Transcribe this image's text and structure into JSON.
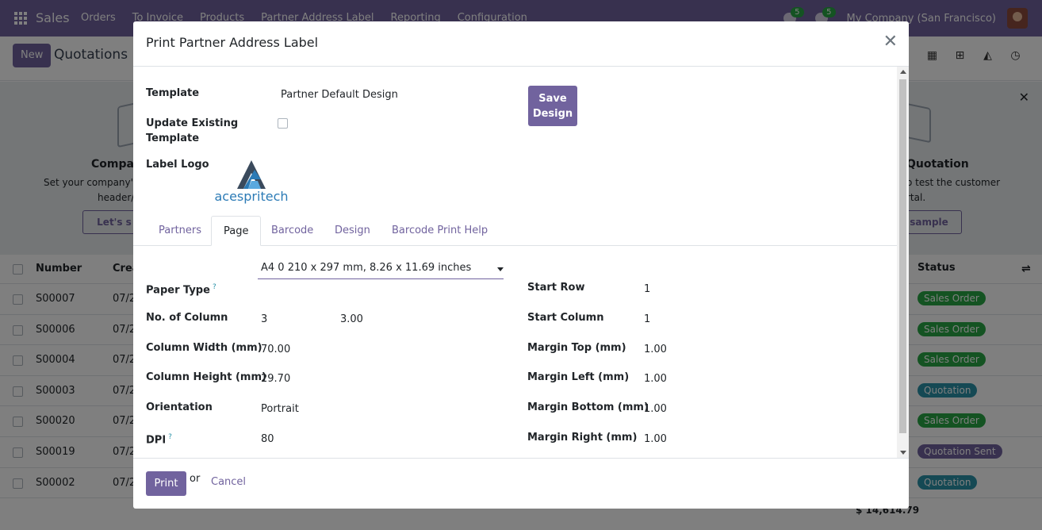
{
  "app": {
    "name": "Sales",
    "menu": [
      "Orders",
      "To Invoice",
      "Products",
      "Partner Address Label",
      "Reporting",
      "Configuration"
    ],
    "messages_badge": "5",
    "activities_badge": "5",
    "company": "My Company (San Francisco)"
  },
  "control_panel": {
    "new_label": "New",
    "title": "Quotations"
  },
  "helper": {
    "left_title": "Compan",
    "left_text_1": "Set your company's d",
    "left_text_2": "header/",
    "left_button": "Let's s",
    "right_title": "Quotation",
    "right_text_1": "o test the customer",
    "right_text_2": "rtal.",
    "right_button": "sample"
  },
  "list": {
    "headers": {
      "number": "Number",
      "creation": "Crea",
      "status": "Status"
    },
    "rows": [
      {
        "number": "S00007",
        "date": "07/2",
        "status": "Sales Order",
        "kind": "order"
      },
      {
        "number": "S00006",
        "date": "07/2",
        "status": "Sales Order",
        "kind": "order"
      },
      {
        "number": "S00004",
        "date": "07/2",
        "status": "Sales Order",
        "kind": "order"
      },
      {
        "number": "S00003",
        "date": "07/2",
        "status": "Quotation",
        "kind": "quote"
      },
      {
        "number": "S00020",
        "date": "07/2",
        "status": "Sales Order",
        "kind": "order"
      },
      {
        "number": "S00019",
        "date": "07/2",
        "status": "Quotation Sent",
        "kind": "sent"
      },
      {
        "number": "S00002",
        "date": "07/2",
        "status": "Quotation",
        "kind": "quote"
      }
    ],
    "total": "$ 14,614.79"
  },
  "dialog": {
    "title": "Print Partner Address Label",
    "template_label": "Template",
    "template_value": "Partner Default Design",
    "update_label_1": "Update Existing",
    "update_label_2": "Template",
    "update_checked": false,
    "logo_label": "Label Logo",
    "logo_text": "acespritech",
    "save_label_1": "Save",
    "save_label_2": "Design",
    "tabs": [
      "Partners",
      "Page",
      "Barcode",
      "Design",
      "Barcode Print Help"
    ],
    "active_tab": "Page",
    "page": {
      "paper_type_label": "Paper Type",
      "paper_type_help": "?",
      "paper_type_value": "A4 0 210 x 297 mm, 8.26 x 11.69 inches",
      "columns_label": "No. of Column",
      "columns_value": "3",
      "columns_extra": "3.00",
      "col_width_label": "Column Width (mm)",
      "col_width_value": "70.00",
      "col_height_label": "Column Height (mm)",
      "col_height_value": "29.70",
      "orientation_label": "Orientation",
      "orientation_value": "Portrait",
      "dpi_label": "DPI",
      "dpi_help": "?",
      "dpi_value": "80",
      "start_row_label": "Start Row",
      "start_row_value": "1",
      "start_col_label": "Start Column",
      "start_col_value": "1",
      "margin_top_label": "Margin Top (mm)",
      "margin_top_value": "1.00",
      "margin_left_label": "Margin Left (mm)",
      "margin_left_value": "1.00",
      "margin_bottom_label": "Margin Bottom (mm)",
      "margin_bottom_value": "1.00",
      "margin_right_label": "Margin Right (mm)",
      "margin_right_value": "1.00"
    },
    "print_label": "Print",
    "or_label": "or",
    "cancel_label": "Cancel"
  },
  "colors": {
    "brand": "#71639e",
    "success": "#28a745",
    "info": "#2a92a8"
  }
}
